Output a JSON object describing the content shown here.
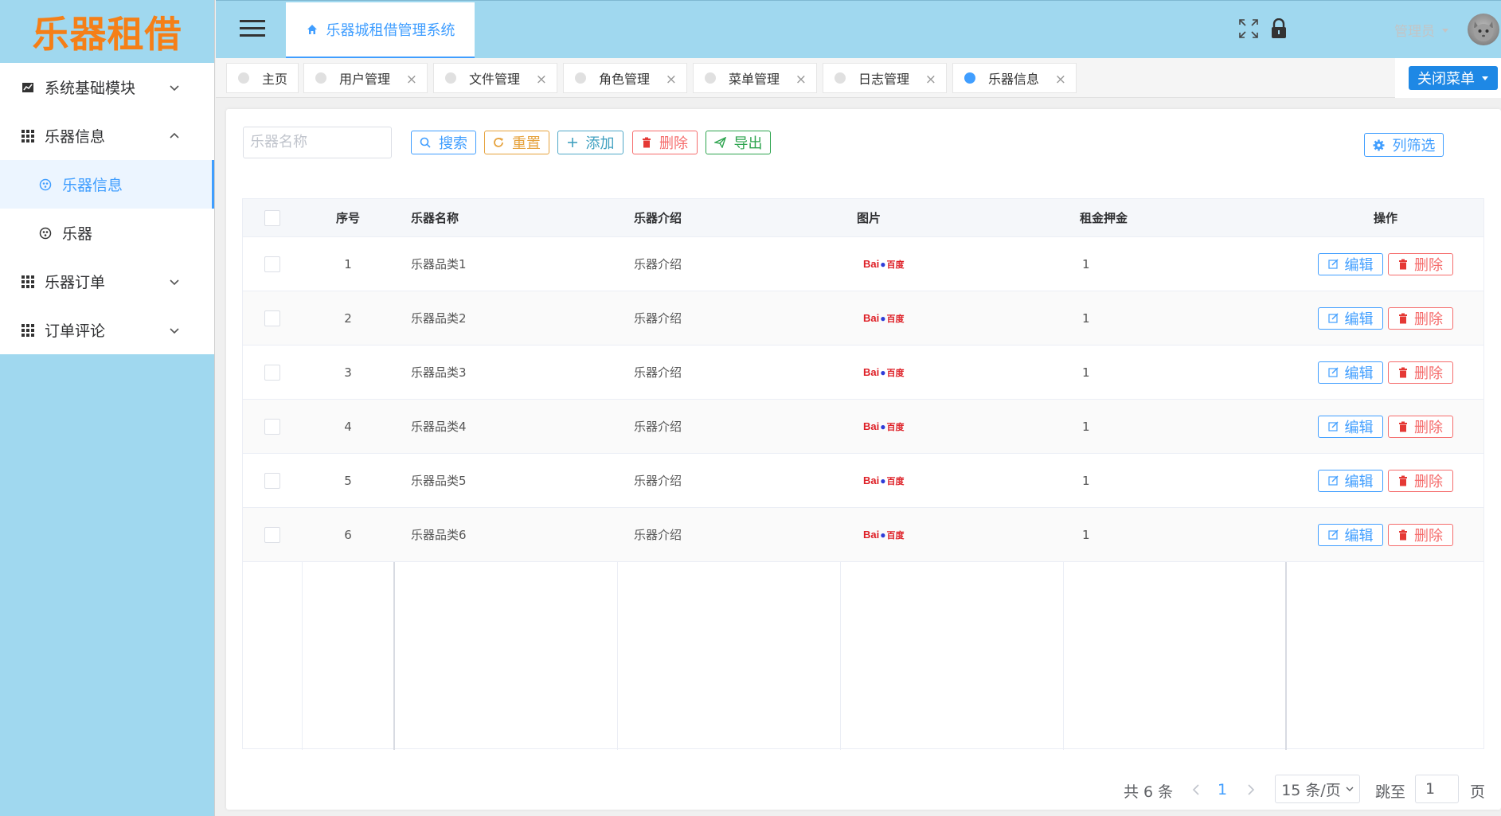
{
  "app": {
    "logo_text": "乐器租借",
    "system_title": "乐器城租借管理系统",
    "admin_label": "管理员"
  },
  "sidebar": {
    "items": [
      {
        "label": "系统基础模块",
        "icon": "chart-icon",
        "expanded": false
      },
      {
        "label": "乐器信息",
        "icon": "grid-icon",
        "expanded": true
      },
      {
        "label": "乐器信息",
        "icon": "circle-icon",
        "sub": true,
        "active": true
      },
      {
        "label": "乐器",
        "icon": "circle-icon",
        "sub": true
      },
      {
        "label": "乐器订单",
        "icon": "grid-icon",
        "expanded": false
      },
      {
        "label": "订单评论",
        "icon": "grid-icon",
        "expanded": false
      }
    ]
  },
  "tags": [
    {
      "label": "主页",
      "closable": false
    },
    {
      "label": "用户管理",
      "closable": true
    },
    {
      "label": "文件管理",
      "closable": true
    },
    {
      "label": "角色管理",
      "closable": true
    },
    {
      "label": "菜单管理",
      "closable": true
    },
    {
      "label": "日志管理",
      "closable": true
    },
    {
      "label": "乐器信息",
      "closable": true,
      "active": true
    }
  ],
  "close_menu_label": "关闭菜单",
  "toolbar": {
    "search_placeholder": "乐器名称",
    "search_label": "搜索",
    "reset_label": "重置",
    "add_label": "添加",
    "delete_label": "删除",
    "export_label": "导出",
    "filter_label": "列筛选"
  },
  "table": {
    "headers": {
      "index": "序号",
      "name": "乐器名称",
      "intro": "乐器介绍",
      "image": "图片",
      "rent": "租金押金",
      "ops": "操作"
    },
    "rows": [
      {
        "index": "1",
        "name": "乐器品类1",
        "intro": "乐器介绍",
        "rent": "1"
      },
      {
        "index": "2",
        "name": "乐器品类2",
        "intro": "乐器介绍",
        "rent": "1"
      },
      {
        "index": "3",
        "name": "乐器品类3",
        "intro": "乐器介绍",
        "rent": "1"
      },
      {
        "index": "4",
        "name": "乐器品类4",
        "intro": "乐器介绍",
        "rent": "1"
      },
      {
        "index": "5",
        "name": "乐器品类5",
        "intro": "乐器介绍",
        "rent": "1"
      },
      {
        "index": "6",
        "name": "乐器品类6",
        "intro": "乐器介绍",
        "rent": "1"
      }
    ],
    "image_logo": {
      "part1": "Bai",
      "part2": "百度"
    },
    "edit_label": "编辑",
    "delete_label": "删除"
  },
  "pagination": {
    "total": "共 6 条",
    "current": "1",
    "page_size": "15 条/页",
    "jump_label": "跳至",
    "jump_value": "1",
    "page_suffix": "页"
  },
  "colors": {
    "sidebar_bg": "#a0d8ef",
    "accent": "#409eff",
    "logo": "#f57f17",
    "danger": "#f56c6c",
    "warning": "#e6a23c",
    "success": "#2ea44f"
  }
}
